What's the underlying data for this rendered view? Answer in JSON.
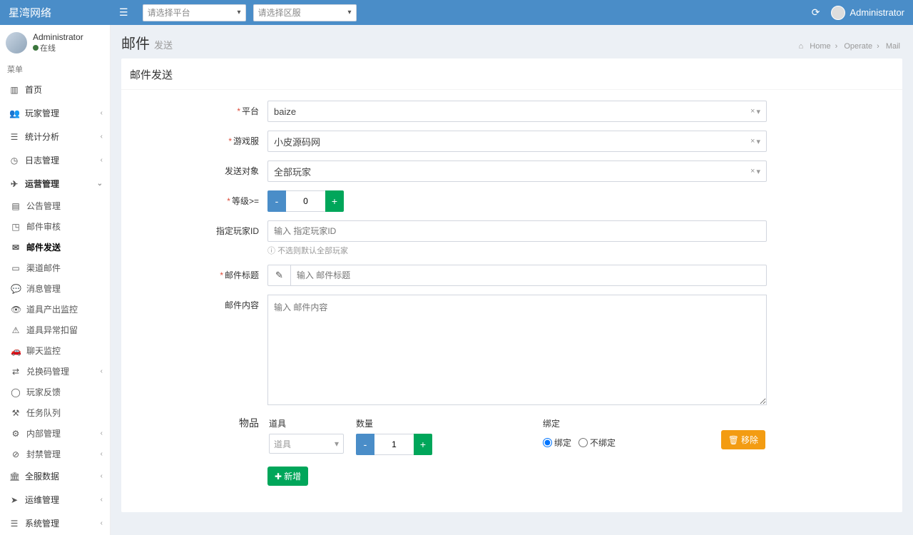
{
  "brand": "星湾网络",
  "topSelects": {
    "platform": "请选择平台",
    "zone": "请选择区服"
  },
  "user": {
    "name": "Administrator",
    "status": "在线"
  },
  "navUser": "Administrator",
  "menuHeader": "菜单",
  "menu": {
    "home": "首页",
    "player": "玩家管理",
    "stats": "统计分析",
    "logs": "日志管理",
    "ops": "运营管理",
    "opsSub": {
      "notice": "公告管理",
      "mailAudit": "邮件审核",
      "mailSend": "邮件发送",
      "channelMail": "渠道邮件",
      "msg": "消息管理",
      "itemOut": "道具产出监控",
      "itemHold": "道具异常扣留",
      "chat": "聊天监控",
      "redeem": "兑换码管理",
      "feedback": "玩家反馈",
      "taskQueue": "任务队列",
      "internal": "内部管理",
      "ban": "封禁管理"
    },
    "fullServer": "全服数据",
    "devops": "运维管理",
    "system": "系统管理"
  },
  "header": {
    "title": "邮件",
    "subtitle": "发送"
  },
  "breadcrumb": {
    "home": "Home",
    "operate": "Operate",
    "mail": "Mail"
  },
  "boxTitle": "邮件发送",
  "form": {
    "platformLabel": "平台",
    "platformValue": "baize",
    "serverLabel": "游戏服",
    "serverValue": "小皮源码网",
    "targetLabel": "发送对象",
    "targetValue": "全部玩家",
    "levelLabel": "等级>=",
    "levelValue": "0",
    "playerIdLabel": "指定玩家ID",
    "playerIdPlaceholder": "输入 指定玩家ID",
    "playerIdHelp": "不选则默认全部玩家",
    "titleLabel": "邮件标题",
    "titlePlaceholder": "输入 邮件标题",
    "contentLabel": "邮件内容",
    "contentPlaceholder": "输入 邮件内容",
    "goodsLabel": "物品",
    "goods": {
      "itemHdr": "道具",
      "itemPlaceholder": "道具",
      "qtyHdr": "数量",
      "qtyValue": "1",
      "bindHdr": "绑定",
      "bindYes": "绑定",
      "bindNo": "不绑定",
      "removeBtn": "移除",
      "addBtn": "新增"
    }
  }
}
